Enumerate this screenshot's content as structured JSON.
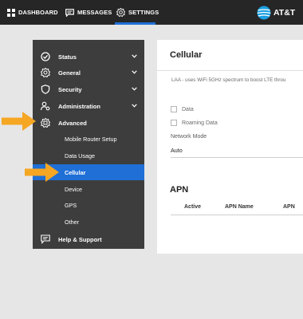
{
  "nav": {
    "dashboard": "DASHBOARD",
    "messages": "MESSAGES",
    "settings": "SETTINGS",
    "brand": "AT&T",
    "active_tab": "settings",
    "accent_color": "#1f6fd6"
  },
  "sidebar": {
    "items": [
      {
        "label": "Status",
        "icon": "check-circle-icon"
      },
      {
        "label": "General",
        "icon": "gear-icon"
      },
      {
        "label": "Security",
        "icon": "shield-icon"
      },
      {
        "label": "Administration",
        "icon": "user-gear-icon"
      },
      {
        "label": "Advanced",
        "icon": "advanced-settings-icon"
      }
    ],
    "sub_items": [
      {
        "label": "Mobile Router Setup"
      },
      {
        "label": "Data Usage"
      },
      {
        "label": "Cellular",
        "active": true
      },
      {
        "label": "Device"
      },
      {
        "label": "GPS"
      },
      {
        "label": "Other"
      }
    ],
    "help": {
      "label": "Help & Support",
      "icon": "chat-icon"
    }
  },
  "panel": {
    "title": "Cellular",
    "laa_text": "LAA - uses WiFi 5GHz spectrum to boost LTE throu",
    "checkboxes": [
      {
        "label": "Data",
        "checked": false
      },
      {
        "label": "Roaming Data",
        "checked": false
      }
    ],
    "network_mode": {
      "label": "Network Mode",
      "value": "Auto"
    },
    "apn": {
      "title": "APN",
      "columns": [
        "Active",
        "APN Name",
        "APN"
      ]
    }
  },
  "annotations": {
    "arrow_color": "#f5a623"
  }
}
